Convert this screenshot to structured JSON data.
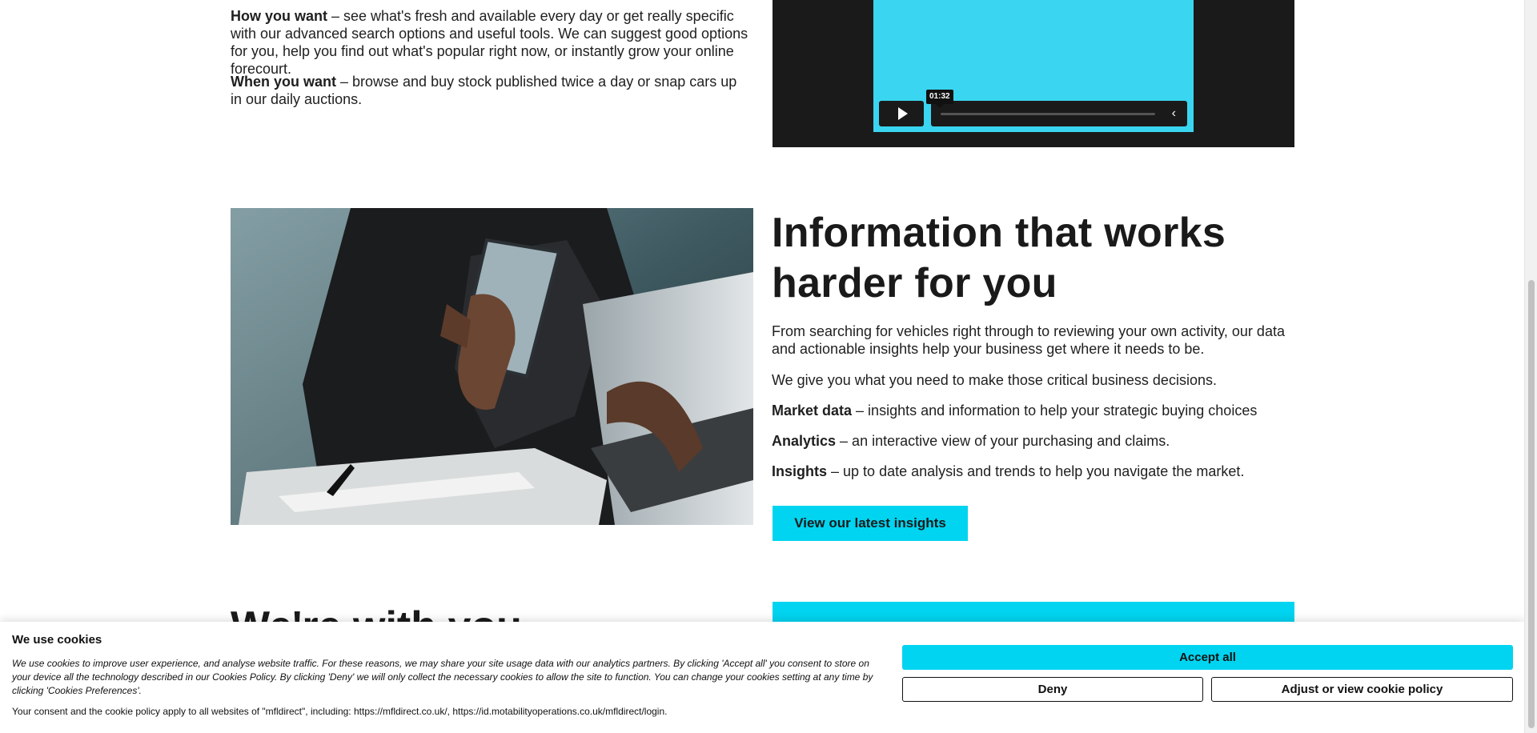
{
  "upper_section": {
    "how_label": "How you want",
    "how_text": " – see what's fresh and available every day or get really specific with our advanced search options and useful tools. We can suggest good options for you, help you find out what's popular right now, or instantly grow your online forecourt.",
    "when_label": "When you want",
    "when_text": " – browse and buy stock published twice a day or snap cars up in our daily auctions."
  },
  "video_player": {
    "time_tooltip": "01:32",
    "collapse_icon": "‹",
    "progress": 0
  },
  "info_section": {
    "heading": "Information that works harder for you",
    "intro": "From searching for vehicles right through to reviewing your own activity, our data and actionable insights help your business get where it needs to be.",
    "statement": "We give you what you need to make those critical business decisions.",
    "features": [
      {
        "label": "Market data",
        "text": " – insights and information to help your strategic buying choices"
      },
      {
        "label": "Analytics",
        "text": " – an interactive view of your purchasing and claims."
      },
      {
        "label": "Insights",
        "text": " – up to date analysis and trends to help you navigate the market."
      }
    ],
    "cta_label": "View our latest insights"
  },
  "next_section": {
    "heading": "We're with you"
  },
  "cookie_banner": {
    "title": "We use cookies",
    "description": "We use cookies to improve user experience, and analyse website traffic. For these reasons, we may share your site usage data with our analytics partners. By clicking 'Accept all' you consent to store on your device all the technology described in our Cookies Policy. By clicking 'Deny' we will only collect the necessary cookies to allow the site to function. You can change your cookies setting at any time by clicking 'Cookies Preferences'.",
    "scope": "Your consent and the cookie policy apply to all websites of \"mfldirect\", including: https://mfldirect.co.uk/, https://id.motabilityoperations.co.uk/mfldirect/login.",
    "accept_label": "Accept all",
    "deny_label": "Deny",
    "adjust_label": "Adjust or view cookie policy"
  },
  "colors": {
    "accent": "#00d4f0",
    "video_screen": "#3ad5f0",
    "dark": "#1a1a1a"
  }
}
